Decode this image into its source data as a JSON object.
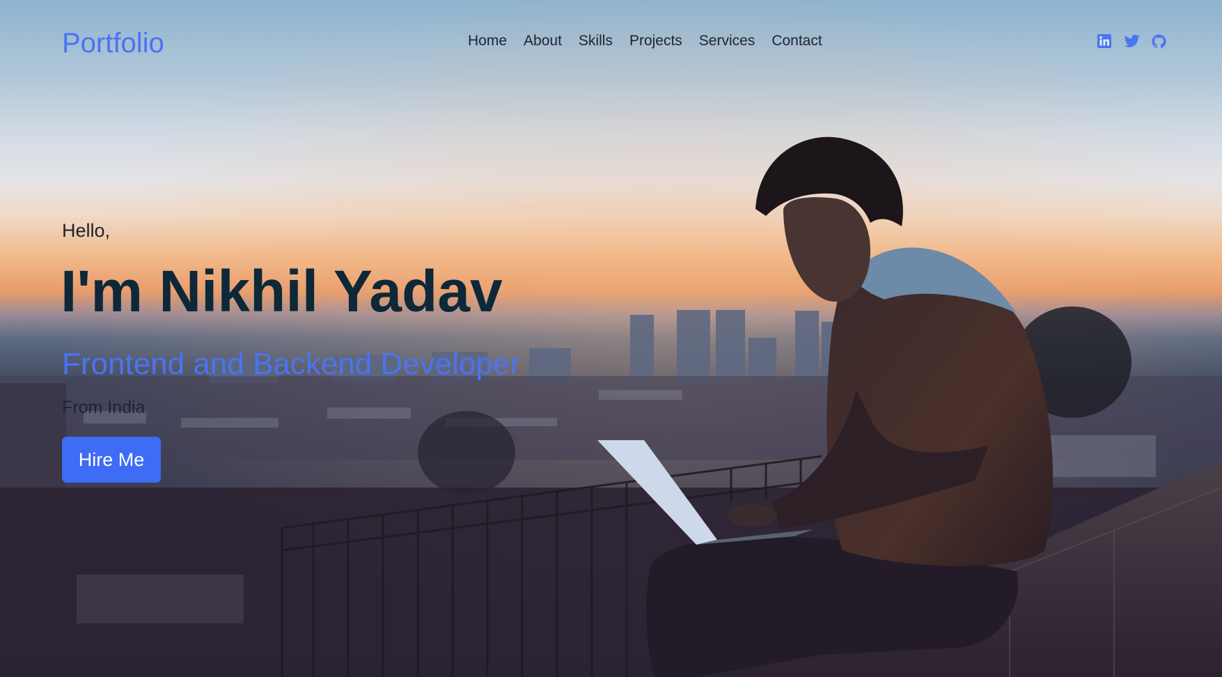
{
  "header": {
    "brand": "Portfolio",
    "nav": [
      "Home",
      "About",
      "Skills",
      "Projects",
      "Services",
      "Contact"
    ],
    "social_icons": [
      "linkedin-icon",
      "twitter-icon",
      "github-icon"
    ]
  },
  "hero": {
    "greeting": "Hello,",
    "name": "I'm Nikhil Yadav",
    "role": "Frontend and Backend Developer",
    "location": "From India",
    "cta_label": "Hire Me"
  },
  "colors": {
    "accent": "#4a74f0",
    "button": "#3f6cf5",
    "heading": "#0d2838",
    "text": "#1d2430"
  }
}
